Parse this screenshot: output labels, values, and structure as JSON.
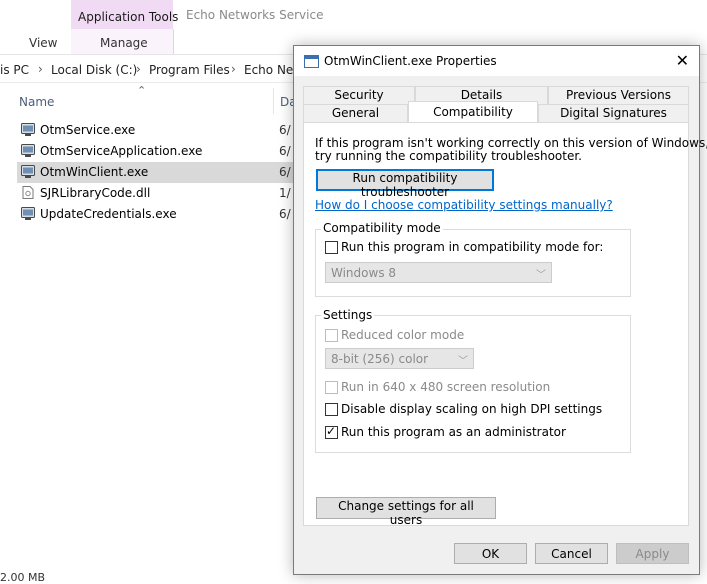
{
  "ribbon": {
    "context_group": "Application Tools",
    "context_tab": "Manage",
    "view_tab": "View",
    "window_title": "Echo Networks Service"
  },
  "address": {
    "crumbs": [
      "is PC",
      "Local Disk (C:)",
      "Program Files",
      "Echo Netw"
    ],
    "separator": "›"
  },
  "files": {
    "columns": {
      "name": "Name",
      "date": "Da"
    },
    "rows": [
      {
        "name": "OtmService.exe",
        "date": "6/",
        "icon": "exe-icon",
        "selected": false
      },
      {
        "name": "OtmServiceApplication.exe",
        "date": "6/",
        "icon": "exe-icon",
        "selected": false
      },
      {
        "name": "OtmWinClient.exe",
        "date": "6/",
        "icon": "exe-icon",
        "selected": true
      },
      {
        "name": "SJRLibraryCode.dll",
        "date": "1/",
        "icon": "dll-icon",
        "selected": false
      },
      {
        "name": "UpdateCredentials.exe",
        "date": "6/",
        "icon": "exe-icon",
        "selected": false
      }
    ],
    "status": "2.00 MB"
  },
  "dialog": {
    "title": "OtmWinClient.exe Properties",
    "close": "✕",
    "tabs_back": [
      "Security",
      "Details",
      "Previous Versions"
    ],
    "tabs_front": [
      "General",
      "Compatibility",
      "Digital Signatures"
    ],
    "intro_line1": "If this program isn't working correctly on this version of Windows,",
    "intro_line2": "try running the compatibility troubleshooter.",
    "troubleshooter_button": "Run compatibility troubleshooter",
    "manual_link": "How do I choose compatibility settings manually?",
    "compat_mode": {
      "label": "Compatibility mode",
      "checkbox": "Run this program in compatibility mode for:",
      "checked": false,
      "select_value": "Windows 8"
    },
    "settings": {
      "label": "Settings",
      "reduced_color": "Reduced color mode",
      "color_select": "8-bit (256) color",
      "run_640": "Run in 640 x 480 screen resolution",
      "disable_dpi": "Disable display scaling on high DPI settings",
      "run_admin": "Run this program as an administrator",
      "run_admin_checked": true
    },
    "change_all_button": "Change settings for all users",
    "ok": "OK",
    "cancel": "Cancel",
    "apply": "Apply"
  }
}
